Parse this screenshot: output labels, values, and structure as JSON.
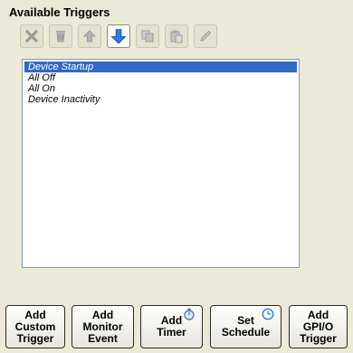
{
  "panel": {
    "title": "Available Triggers"
  },
  "toolbar": [
    {
      "name": "delete-icon",
      "enabled": false
    },
    {
      "name": "trash-icon",
      "enabled": false
    },
    {
      "name": "arrow-up-icon",
      "enabled": false
    },
    {
      "name": "arrow-down-icon",
      "enabled": true
    },
    {
      "name": "copy-icon",
      "enabled": false
    },
    {
      "name": "paste-icon",
      "enabled": false
    },
    {
      "name": "edit-pencil-icon",
      "enabled": false
    }
  ],
  "triggers": {
    "items": [
      "Device Startup",
      "All Off",
      "All On",
      "Device Inactivity"
    ],
    "selected_index": 0
  },
  "buttons": {
    "add_custom_trigger": "Add\nCustom\nTrigger",
    "add_monitor_event": "Add\nMonitor\nEvent",
    "add_timer": "Add\nTimer",
    "set_schedule": "Set\nSchedule",
    "add_gpio_trigger": "Add\nGPI/O\nTrigger"
  },
  "colors": {
    "background": "#ece9d8",
    "selection": "#316ac5",
    "list_border": "#7f9db9",
    "accent_icon": "#2a7fdc"
  }
}
